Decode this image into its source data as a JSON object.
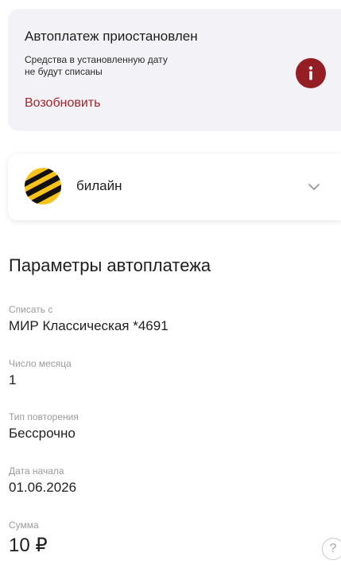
{
  "alert": {
    "title": "Автоплатеж приостановлен",
    "text_line1": "Средства в установленную дату",
    "text_line2": "не будут списаны",
    "action": "Возобновить",
    "icon": "info-icon",
    "accent_color": "#951d24"
  },
  "provider": {
    "name": "билайн",
    "logo": "beeline-logo",
    "chevron": "chevron-down-icon"
  },
  "params": {
    "title": "Параметры автоплатежа",
    "fields": [
      {
        "label": "Списать с",
        "value": "МИР Классическая *4691"
      },
      {
        "label": "Число месяца",
        "value": "1"
      },
      {
        "label": "Тип повторения",
        "value": "Бессрочно"
      },
      {
        "label": "Дата начала",
        "value": "01.06.2026"
      },
      {
        "label": "Сумма",
        "value": "10 ₽"
      }
    ],
    "help_icon": "question-icon",
    "help_symbol": "?"
  }
}
